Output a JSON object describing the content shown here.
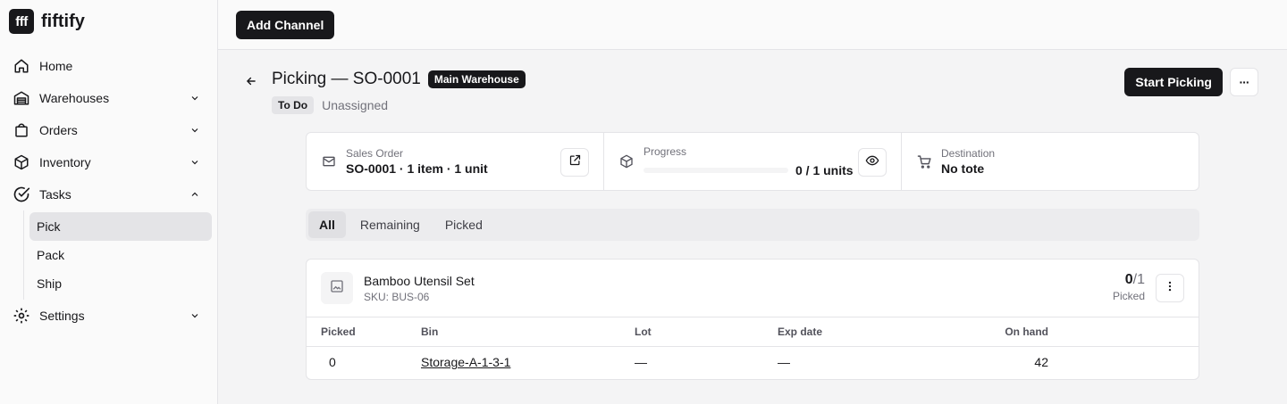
{
  "brand": {
    "logo_text": "fff",
    "name": "fiftify"
  },
  "sidebar": {
    "items": [
      {
        "label": "Home",
        "icon": "home-icon"
      },
      {
        "label": "Warehouses",
        "icon": "warehouse-icon"
      },
      {
        "label": "Orders",
        "icon": "shopping-bag-icon"
      },
      {
        "label": "Inventory",
        "icon": "box-icon"
      },
      {
        "label": "Tasks",
        "icon": "check-circle-icon"
      },
      {
        "label": "Settings",
        "icon": "gear-icon"
      }
    ],
    "subitems": [
      {
        "label": "Pick",
        "active": true
      },
      {
        "label": "Pack"
      },
      {
        "label": "Ship"
      }
    ]
  },
  "topbar": {
    "add_channel_label": "Add Channel"
  },
  "header": {
    "title": "Picking — SO-0001",
    "warehouse_badge": "Main Warehouse",
    "status_badge": "To Do",
    "assignee": "Unassigned",
    "start_label": "Start Picking",
    "more_label": "···"
  },
  "info": {
    "sales_order_label": "Sales Order",
    "sales_order_value": "SO-0001 · 1 item · 1 unit",
    "progress_label": "Progress",
    "progress_text": "0 / 1 units",
    "progress_fraction": 0,
    "destination_label": "Destination",
    "destination_value": "No tote"
  },
  "tabs": [
    {
      "label": "All",
      "active": true
    },
    {
      "label": "Remaining"
    },
    {
      "label": "Picked"
    }
  ],
  "item": {
    "name": "Bamboo Utensil Set",
    "sku": "SKU: BUS-06",
    "picked_count": "0",
    "total_count": "/1",
    "count_label": "Picked"
  },
  "table": {
    "headers": {
      "picked": "Picked",
      "bin": "Bin",
      "lot": "Lot",
      "exp": "Exp date",
      "on_hand": "On hand"
    },
    "rows": [
      {
        "picked": "0",
        "bin": "Storage-A-1-3-1",
        "lot": "—",
        "exp": "—",
        "on_hand": "42"
      }
    ]
  },
  "colors": {
    "primary": "#18181b",
    "muted": "#71717a",
    "border": "#e4e4e7",
    "background": "#f4f4f5"
  }
}
